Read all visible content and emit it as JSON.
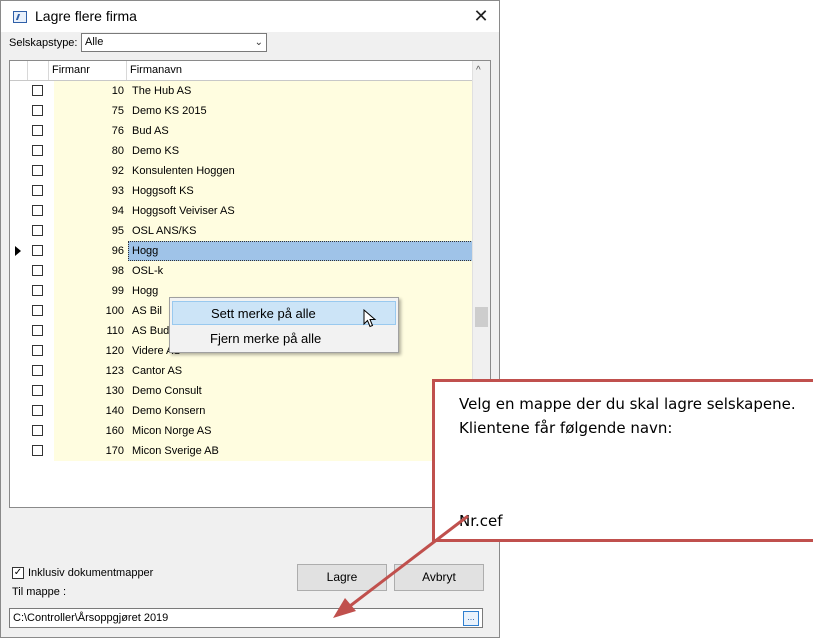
{
  "window": {
    "title": "Lagre flere firma",
    "close_glyph": "✕"
  },
  "filter": {
    "label": "Selskapstype:",
    "value": "Alle"
  },
  "grid": {
    "col_number": "Firmanr",
    "col_name": "Firmanavn",
    "rows": [
      {
        "num": "10",
        "name": "The Hub AS"
      },
      {
        "num": "75",
        "name": "Demo KS 2015"
      },
      {
        "num": "76",
        "name": "Bud AS"
      },
      {
        "num": "80",
        "name": "Demo KS"
      },
      {
        "num": "92",
        "name": "Konsulenten Hoggen"
      },
      {
        "num": "93",
        "name": "Hoggsoft KS"
      },
      {
        "num": "94",
        "name": "Hoggsoft Veiviser AS"
      },
      {
        "num": "95",
        "name": "OSL ANS/KS"
      },
      {
        "num": "96",
        "name": "Hogg"
      },
      {
        "num": "98",
        "name": "OSL-k"
      },
      {
        "num": "99",
        "name": "Hogg"
      },
      {
        "num": "100",
        "name": "AS Bil"
      },
      {
        "num": "110",
        "name": "AS Budsjett"
      },
      {
        "num": "120",
        "name": "Videre AS"
      },
      {
        "num": "123",
        "name": "Cantor AS"
      },
      {
        "num": "130",
        "name": "Demo Consult"
      },
      {
        "num": "140",
        "name": "Demo Konsern"
      },
      {
        "num": "160",
        "name": "Micon Norge AS"
      },
      {
        "num": "170",
        "name": "Micon Sverige AB"
      }
    ]
  },
  "context_menu": {
    "item1": "Sett merke på alle",
    "item2": "Fjern merke på alle"
  },
  "options": {
    "include_docs_label": "Inklusiv dokumentmapper",
    "include_docs_checked": true,
    "target_label": "Til mappe :"
  },
  "buttons": {
    "save": "Lagre",
    "cancel": "Avbryt",
    "browse": "..."
  },
  "path": {
    "value": "C:\\Controller\\Årsoppgjøret 2019"
  },
  "callout": {
    "text": "Velg en mappe der du skal lagre selskapene. Klientene får følgende navn:",
    "example": "Nr.cef",
    "border_color": "#c0504d"
  }
}
